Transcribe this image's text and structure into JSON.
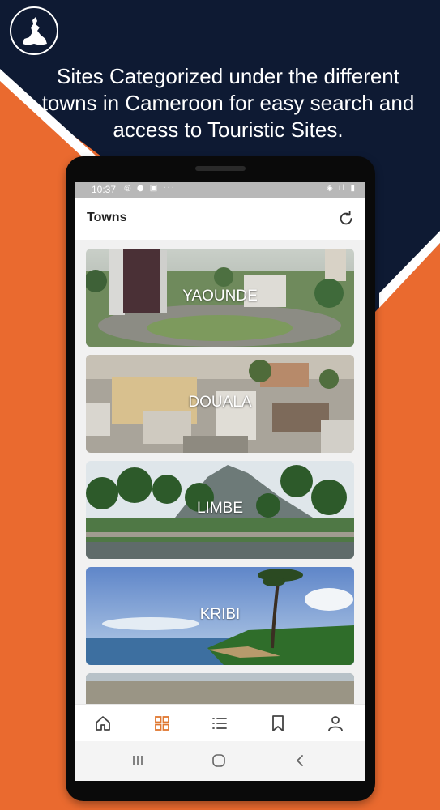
{
  "promo": {
    "headline": "Sites Categorized under the different towns in Cameroon for easy search and access to Touristic Sites.",
    "colors": {
      "navy": "#0e1a33",
      "orange": "#ea6a2f",
      "white": "#ffffff"
    },
    "logo_icon": "cameroon-map-icon"
  },
  "status_bar": {
    "time": "10:37",
    "left_icons": "◎ ● ▣ ···",
    "right_icons": "◈ ıl ▮"
  },
  "app_bar": {
    "title": "Towns",
    "refresh_icon": "refresh-icon"
  },
  "towns": [
    {
      "name": "YAOUNDE"
    },
    {
      "name": "DOUALA"
    },
    {
      "name": "LIMBE"
    },
    {
      "name": "KRIBI"
    },
    {
      "name": ""
    }
  ],
  "bottom_nav": {
    "items": [
      {
        "icon": "home-icon",
        "active": false
      },
      {
        "icon": "grid-icon",
        "active": true
      },
      {
        "icon": "list-icon",
        "active": false
      },
      {
        "icon": "bookmark-icon",
        "active": false
      },
      {
        "icon": "profile-icon",
        "active": false
      }
    ],
    "active_color": "#e0772f",
    "inactive_color": "#444444"
  },
  "system_nav": {
    "items": [
      "recents-icon",
      "home-circle-icon",
      "back-icon"
    ]
  }
}
